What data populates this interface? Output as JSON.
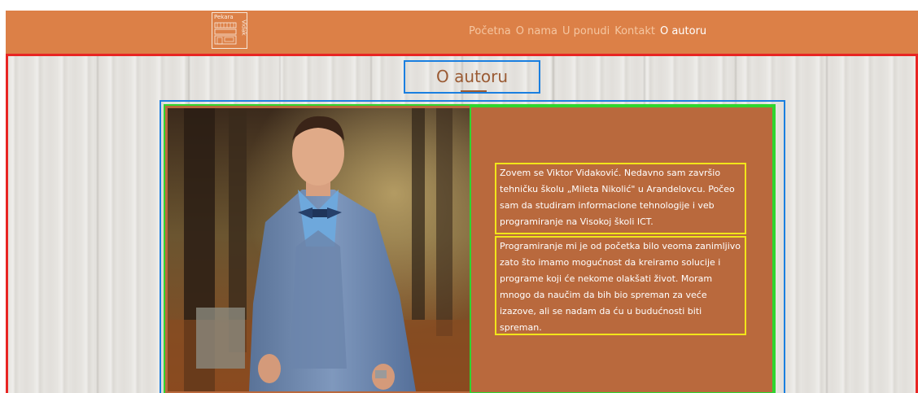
{
  "logo": {
    "top_text": "Pekara",
    "side_text": "Vidak"
  },
  "nav": {
    "items": [
      {
        "label": "Početna"
      },
      {
        "label": "O nama"
      },
      {
        "label": "U ponudi"
      },
      {
        "label": "Kontakt"
      },
      {
        "label": "O autoru"
      }
    ],
    "active_index": 4
  },
  "main": {
    "title": "O autoru",
    "photo_alt": "author-photo",
    "paragraphs": [
      "Zovem se Viktor Vidaković. Nedavno sam završio tehničku školu „Mileta Nikolić\" u Arandelovcu. Počeo sam da studiram informacione tehnologije i veb programiranje na Visokoj školi ICT.",
      "Programiranje mi je od početka bilo veoma zanimljivo zato što imamo mogućnost da kreiramo solucije i programe koji će nekome olakšati život. Moram mnogo da naučim da bih bio spreman za veće izazove, ali se nadam da ću u budućnosti biti spreman."
    ]
  },
  "colors": {
    "navbar": "#dc8047",
    "content_bg": "#b9693d",
    "title_text": "#9a5a33",
    "outline_red": "#e82523",
    "outline_blue": "#1a7fe0",
    "outline_green": "#2fd52f",
    "outline_yellow": "#f2e51a"
  }
}
